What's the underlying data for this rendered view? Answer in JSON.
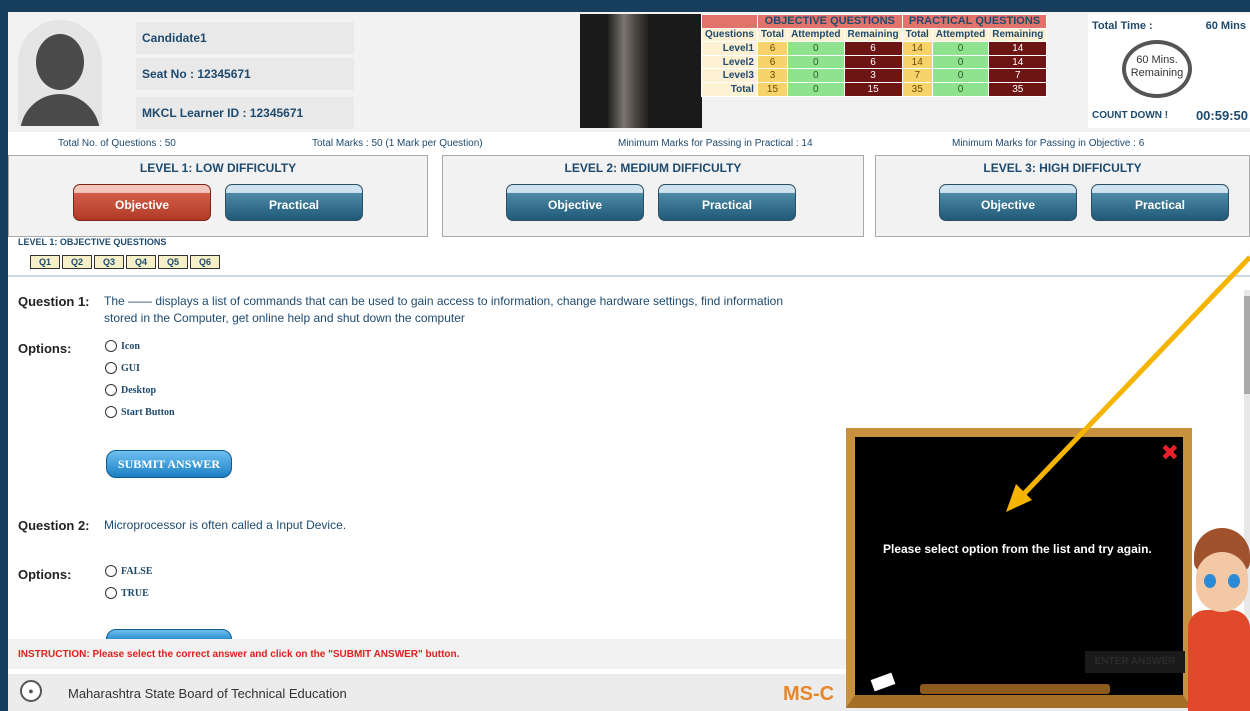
{
  "candidate": {
    "name": "Candidate1",
    "seat": "Seat No : 12345671",
    "learner_id": "MKCL Learner ID : 12345671"
  },
  "stats": {
    "objective_header": "OBJECTIVE QUESTIONS",
    "practical_header": "PRACTICAL QUESTIONS",
    "col_questions": "Questions",
    "cols": [
      "Total",
      "Attempted",
      "Remaining"
    ],
    "rows": [
      {
        "label": "Level1",
        "obj": [
          "6",
          "0",
          "6"
        ],
        "prac": [
          "14",
          "0",
          "14"
        ]
      },
      {
        "label": "Level2",
        "obj": [
          "6",
          "0",
          "6"
        ],
        "prac": [
          "14",
          "0",
          "14"
        ]
      },
      {
        "label": "Level3",
        "obj": [
          "3",
          "0",
          "3"
        ],
        "prac": [
          "7",
          "0",
          "7"
        ]
      },
      {
        "label": "Total",
        "obj": [
          "15",
          "0",
          "15"
        ],
        "prac": [
          "35",
          "0",
          "35"
        ]
      }
    ]
  },
  "timer": {
    "total_label": "Total Time :",
    "total_value": "60 Mins",
    "remaining_line1": "60 Mins.",
    "remaining_line2": "Remaining",
    "countdown_label": "COUNT DOWN !",
    "countdown_value": "00:59:50"
  },
  "meta": {
    "total_questions": "Total No. of Questions :  50",
    "total_marks": "Total Marks : 50  (1 Mark per Question)",
    "min_practical": "Minimum Marks for Passing in Practical :  14",
    "min_objective": "Minimum Marks for Passing in Objective :  6"
  },
  "levels": [
    {
      "title": "LEVEL 1: LOW DIFFICULTY",
      "objective": "Objective",
      "practical": "Practical"
    },
    {
      "title": "LEVEL 2: MEDIUM DIFFICULTY",
      "objective": "Objective",
      "practical": "Practical"
    },
    {
      "title": "LEVEL 3: HIGH DIFFICULTY",
      "objective": "Objective",
      "practical": "Practical"
    }
  ],
  "section_title": "LEVEL 1:  OBJECTIVE QUESTIONS",
  "question_nav": [
    "Q1",
    "Q2",
    "Q3",
    "Q4",
    "Q5",
    "Q6"
  ],
  "q1": {
    "label": "Question 1:",
    "line1": "The —— displays a list of commands that can be used to gain access to information, change hardware settings, find information",
    "line2": "stored in the Computer, get online help and shut down the computer",
    "options_label": "Options:",
    "options": [
      "Icon",
      "GUI",
      "Desktop",
      "Start Button"
    ]
  },
  "submit_label": "SUBMIT ANSWER",
  "q2": {
    "label": "Question 2:",
    "text": "Microprocessor is often called a Input Device.",
    "options_label": "Options:",
    "options": [
      "FALSE",
      "TRUE"
    ]
  },
  "instruction": "INSTRUCTION:  Please select the correct answer and click on the \"SUBMIT ANSWER\" button.",
  "footer": {
    "org": "Maharashtra State Board of Technical Education",
    "brand": "MS-C"
  },
  "dialog": {
    "message": "Please select option from the list and try again.",
    "close": "✖",
    "button": "ENTER ANSWER"
  },
  "colors": {
    "accent_red": "#d25e4a",
    "blue_button": "#1f5a78",
    "arrow": "#f5b400"
  }
}
